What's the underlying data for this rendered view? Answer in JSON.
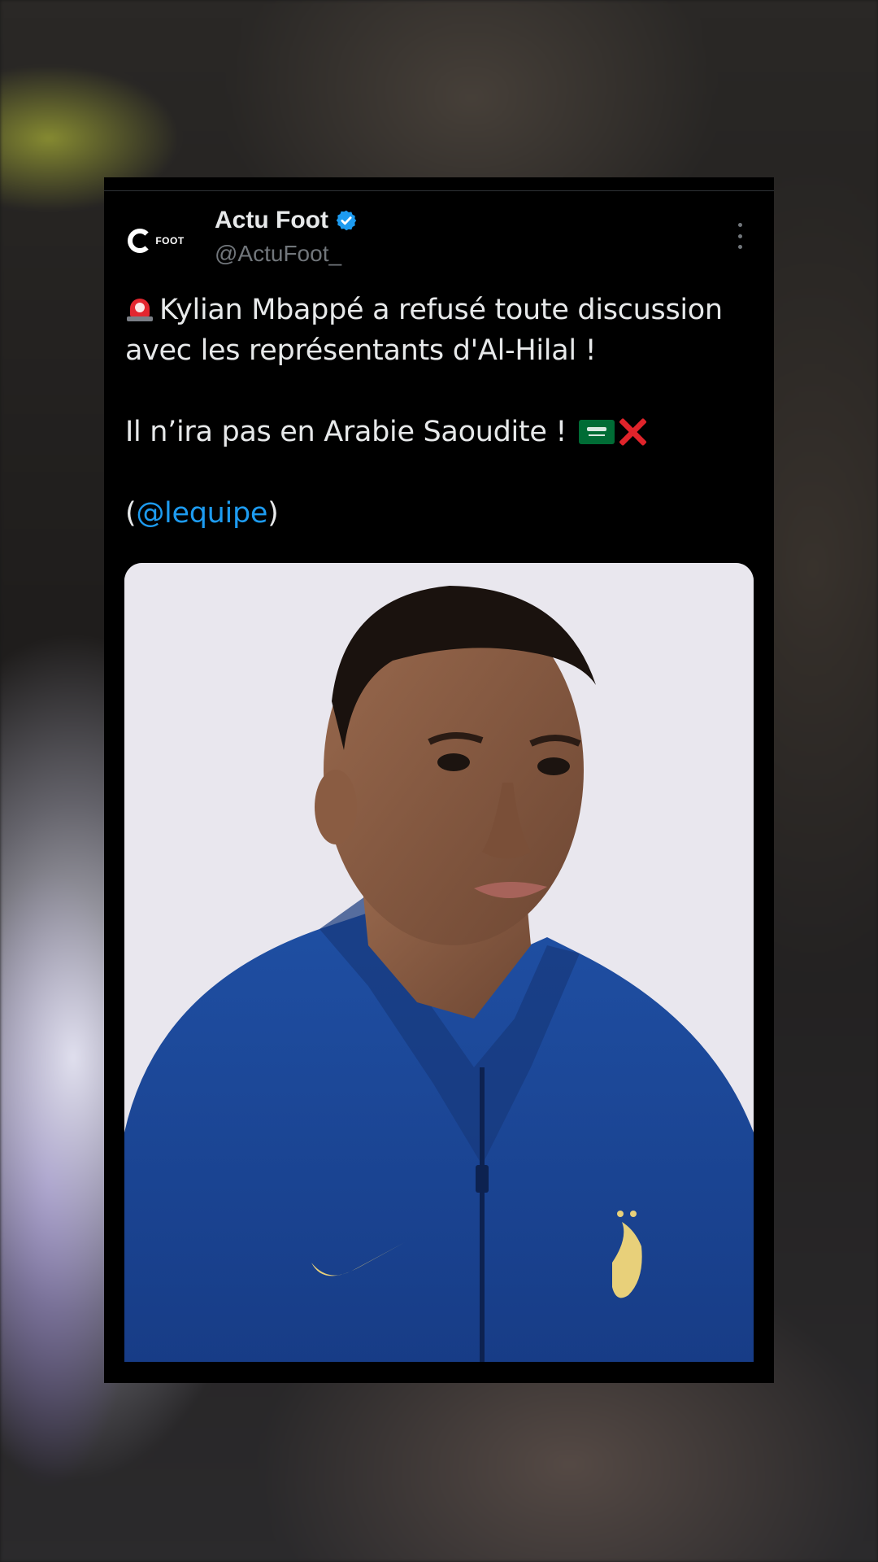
{
  "account": {
    "display_name": "Actu Foot",
    "handle": "@ActuFoot_",
    "verified": true,
    "avatar_icon": "actufoot-logo-icon",
    "avatar_text": "FOOT"
  },
  "tweet": {
    "line1": "Kylian Mbappé a refusé toute discussion avec les représentants d'Al-Hilal !",
    "line2": "Il n’ira pas en Arabie Saoudite !",
    "line3_open": "(",
    "mention": "@lequipe",
    "line3_close": ")",
    "emojis": {
      "lead": "police-siren-icon",
      "flag": "saudi-arabia-flag-icon",
      "cross": "cross-mark-icon"
    }
  },
  "media": {
    "icon": "photo-player-in-blue-france-jacket"
  },
  "colors": {
    "card_background": "#000000",
    "text_primary": "#e7e9ea",
    "text_secondary": "#71767b",
    "link": "#1d9bf0",
    "verified_badge": "#1d9bf0"
  }
}
